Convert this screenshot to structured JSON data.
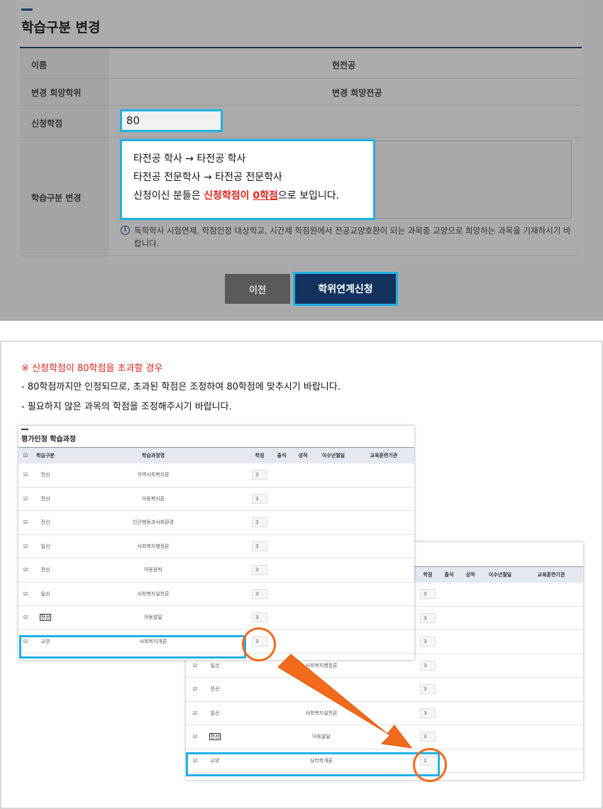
{
  "form": {
    "title": "학습구분 변경",
    "labels": {
      "name": "이름",
      "current_major": "현전공",
      "desired_degree": "변경 희망학위",
      "desired_major": "변경 희망전공",
      "credits": "신청학점",
      "study_type_change": "학습구분 변경"
    },
    "credits_value": "80",
    "callout": {
      "line1": "타전공 학사 → 타전공 학사",
      "line2": "타전공 전문학사 → 타전공 전문학사",
      "line3_prefix": "신청이신 분들은 ",
      "line3_red": "신청학점이 ",
      "line3_red_underline": "0학점",
      "line3_suffix": "으로 보입니다."
    },
    "info_text": "독학학사 시험면제, 학점인정 대상학교, 시간제 학점원에서 전공교양호환이 되는 과목중 교양으로 희망하는 과목을 기재하시기 바랍니다.",
    "buttons": {
      "prev": "이전",
      "apply": "학위연계신청"
    }
  },
  "guide": {
    "notice_title": "※ 신청학점이 80학점을 초과할 경우",
    "notice_line1": "- 80학점까지만 인정되므로, 초과된 학점은 조정하여 80학점에 맞추시기 바랍니다.",
    "notice_line2": "- 필요하지 않은 과목의 학점을 조정해주시기 바랍니다."
  },
  "table_front": {
    "title": "평가인정 학습과정",
    "headers": [
      "학습구분",
      "학습과정명",
      "학점",
      "출석",
      "성적",
      "이수년월일",
      "교육훈련기관"
    ],
    "rows": [
      {
        "type": "전선",
        "course": "지역사회복지론",
        "credit": "3"
      },
      {
        "type": "전선",
        "course": "아동복지론",
        "credit": "3"
      },
      {
        "type": "전선",
        "course": "인간행동과사회환경",
        "credit": "3"
      },
      {
        "type": "일선",
        "course": "사회복지행정론",
        "credit": "3"
      },
      {
        "type": "전선",
        "course": "아동문학",
        "credit": "3"
      },
      {
        "type": "일선",
        "course": "사회복지실천론",
        "credit": "3"
      },
      {
        "type": "전선",
        "course": "아동발달",
        "credit": "3"
      },
      {
        "type": "교양",
        "course": "사회복지개론",
        "credit": "3"
      }
    ]
  },
  "table_back": {
    "headers": [
      "학점",
      "출석",
      "성적",
      "이수년월일",
      "교육훈련기관"
    ],
    "rows": [
      {
        "type": "",
        "course": "",
        "credit": "3"
      },
      {
        "type": "",
        "course": "",
        "credit": "3"
      },
      {
        "type": "",
        "course": "",
        "credit": "3"
      },
      {
        "type": "일선",
        "course": "사회복지행정론",
        "credit": "3"
      },
      {
        "type": "전선",
        "course": "",
        "credit": "3"
      },
      {
        "type": "일선",
        "course": "사회복지실천론",
        "credit": "3"
      },
      {
        "type": "전선",
        "course": "아동발달",
        "credit": "3"
      },
      {
        "type": "교양",
        "course": "심리학개론",
        "credit": "2"
      }
    ]
  },
  "colors": {
    "highlight_blue": "#1fb0e6",
    "highlight_orange": "#f26a1b",
    "notice_red": "#e0241b",
    "navy": "#13325e"
  }
}
